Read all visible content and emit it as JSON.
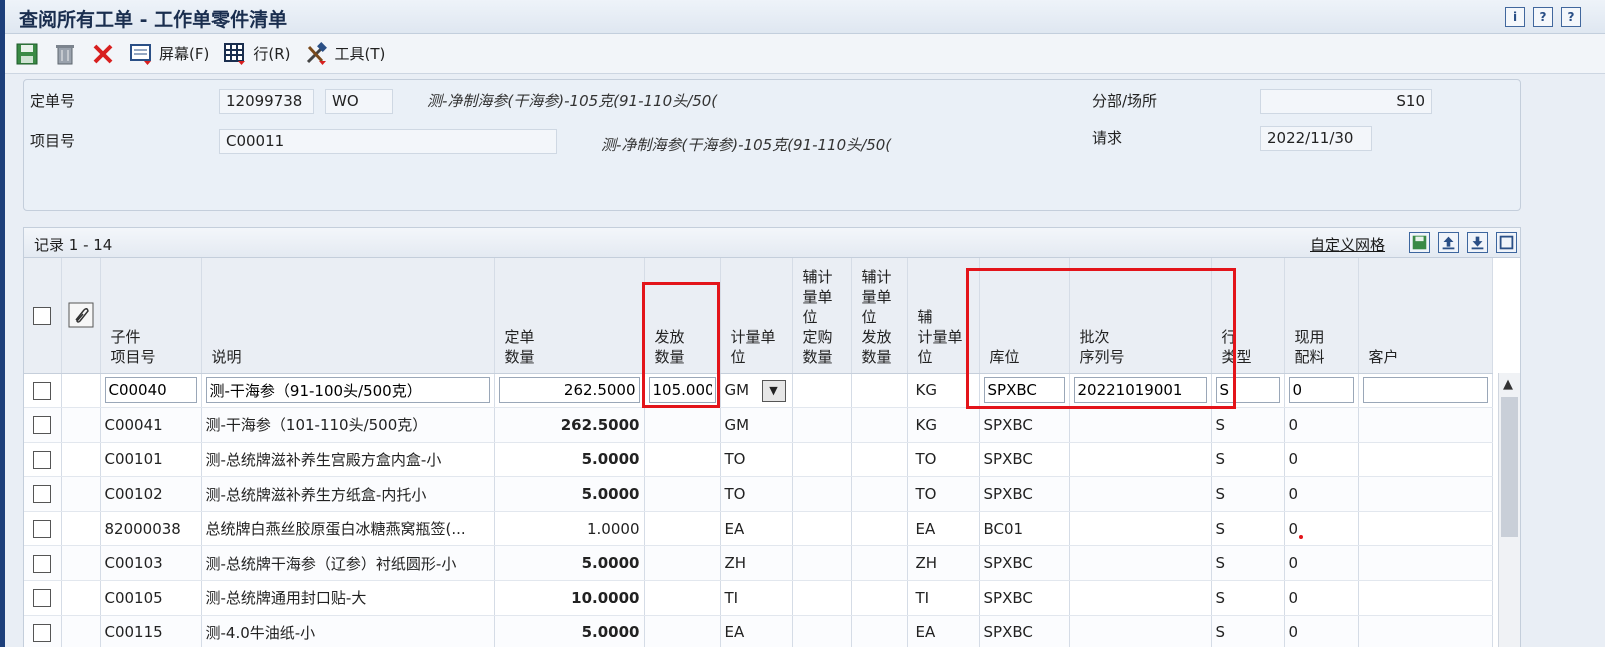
{
  "window": {
    "title": "查阅所有工单 - 工作单零件清单"
  },
  "title_icons": [
    "i",
    "?",
    "?"
  ],
  "toolbar": {
    "screen_label": "屏幕(F)",
    "row_label": "行(R)",
    "tools_label": "工具(T)"
  },
  "header": {
    "order_no_label": "定单号",
    "order_no": "12099738",
    "order_type": "WO",
    "order_desc": "测-净制海参(干海参)-105克(91-110头/50(",
    "item_no_label": "项目号",
    "item_no": "C00011",
    "item_desc": "测-净制海参(干海参)-105克(91-110头/50(",
    "branch_label": "分部/场所",
    "branch": "S10",
    "request_label": "请求",
    "request_date": "2022/11/30"
  },
  "grid": {
    "records": "记录 1 - 14",
    "custom_grid": "自定义网格",
    "columns": [
      "子件\n项目号",
      "说明",
      "定单\n数量",
      "发放\n数量",
      "计量单\n位",
      "辅计\n量单\n位\n定购\n数量",
      "辅计\n量单\n位\n发放\n数量",
      "辅\n计量单\n位",
      "库位",
      "批次\n序列号",
      "行\n类型",
      "现用\n配料",
      "客户"
    ],
    "edit_row": {
      "item": "C00040",
      "desc": "测-干海参（91-100头/500克）",
      "qty": "262.5000",
      "issue_qty": "105.0000",
      "uom": "GM",
      "uom2": "KG",
      "location": "SPXBC",
      "lot": "20221019001",
      "line_type": "S",
      "active": "0",
      "customer": ""
    },
    "rows": [
      {
        "item": "C00041",
        "desc": "测-干海参（101-110头/500克）",
        "qty": "262.5000",
        "bold": true,
        "uom": "GM",
        "uom2": "KG",
        "location": "SPXBC",
        "line_type": "S",
        "active": "0"
      },
      {
        "item": "C00101",
        "desc": "测-总统牌滋补养生宫殿方盒内盒-小",
        "qty": "5.0000",
        "bold": true,
        "uom": "TO",
        "uom2": "TO",
        "location": "SPXBC",
        "line_type": "S",
        "active": "0"
      },
      {
        "item": "C00102",
        "desc": "测-总统牌滋补养生方纸盒-内托小",
        "qty": "5.0000",
        "bold": true,
        "uom": "TO",
        "uom2": "TO",
        "location": "SPXBC",
        "line_type": "S",
        "active": "0"
      },
      {
        "item": "82000038",
        "desc": "总统牌白燕丝胶原蛋白冰糖燕窝瓶签(...",
        "qty": "1.0000",
        "bold": false,
        "uom": "EA",
        "uom2": "EA",
        "location": "BC01",
        "line_type": "S",
        "active": "0"
      },
      {
        "item": "C00103",
        "desc": "测-总统牌干海参（辽参）衬纸圆形-小",
        "qty": "5.0000",
        "bold": true,
        "uom": "ZH",
        "uom2": "ZH",
        "location": "SPXBC",
        "line_type": "S",
        "active": "0"
      },
      {
        "item": "C00105",
        "desc": "测-总统牌通用封口贴-大",
        "qty": "10.0000",
        "bold": true,
        "uom": "TI",
        "uom2": "TI",
        "location": "SPXBC",
        "line_type": "S",
        "active": "0"
      },
      {
        "item": "C00115",
        "desc": "测-4.0牛油纸-小",
        "qty": "5.0000",
        "bold": true,
        "uom": "EA",
        "uom2": "EA",
        "location": "SPXBC",
        "line_type": "S",
        "active": "0"
      }
    ]
  }
}
